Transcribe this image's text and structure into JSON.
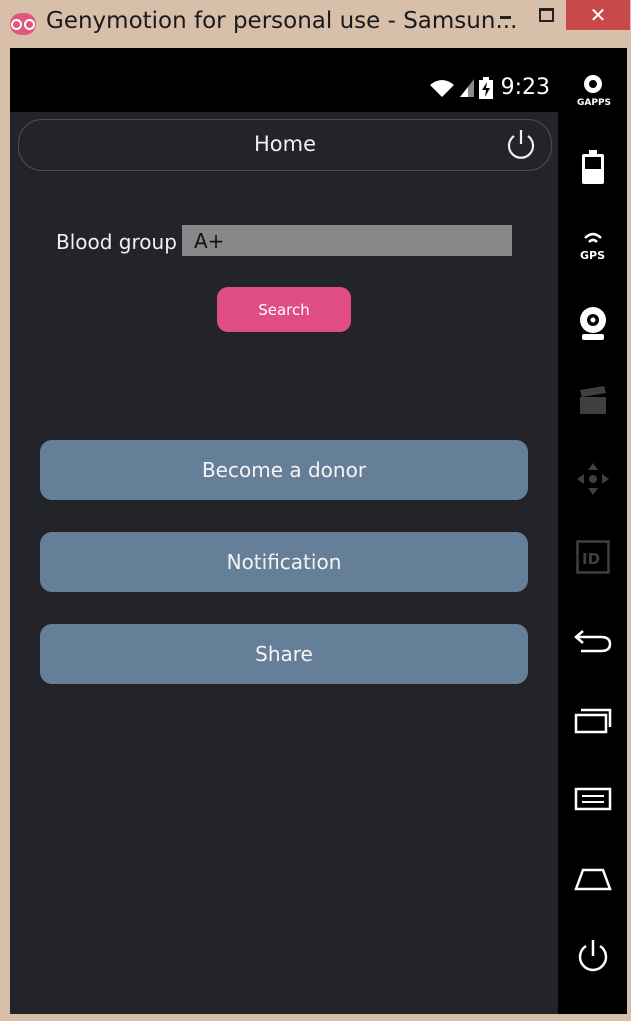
{
  "window": {
    "title": "Genymotion for personal use - Samsun...",
    "close_glyph": "✕"
  },
  "statusbar": {
    "time": "9:23",
    "icons": [
      "wifi-icon",
      "signal-icon",
      "battery-charging-icon"
    ]
  },
  "actionbar": {
    "title": "Home",
    "power_icon": "power-icon"
  },
  "form": {
    "blood_group_label": "Blood group :",
    "blood_group_value": "A+",
    "search_label": "Search"
  },
  "menu": {
    "donor_label": "Become a donor",
    "notification_label": "Notification",
    "share_label": "Share"
  },
  "toolbar": {
    "gapps_label": "GAPPS",
    "gps_label": "GPS",
    "id_label": "ID",
    "items": [
      "gapps-icon",
      "battery-icon",
      "gps-icon",
      "webcam-icon",
      "media-icon",
      "dpad-icon",
      "id-icon",
      "back-icon",
      "recent-apps-icon",
      "menu-icon",
      "home-icon",
      "power-icon"
    ]
  },
  "colors": {
    "screen_bg": "#222429",
    "menu_button": "#667f99",
    "search_button": "#e04c84",
    "input_bg": "#86888a"
  }
}
